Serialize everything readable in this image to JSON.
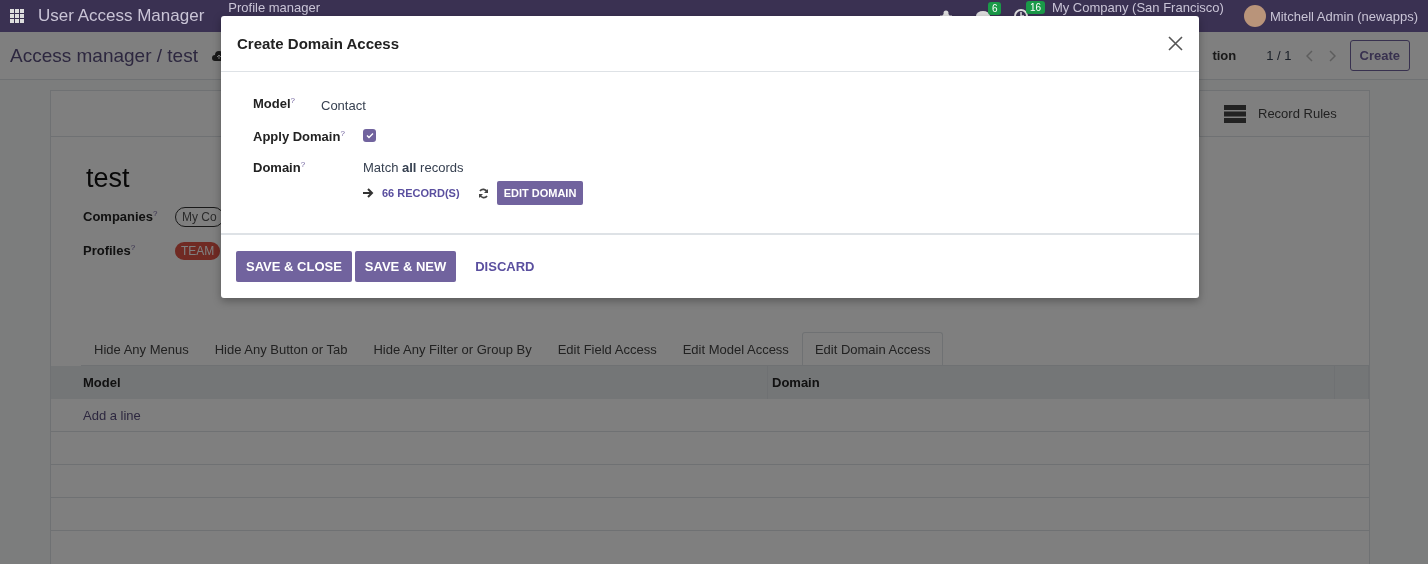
{
  "navbar": {
    "app_title": "User Access Manager",
    "menus": [
      "Profile manager"
    ],
    "messages_badge": "6",
    "activities_badge": "16",
    "company": "My Company (San Francisco)",
    "user": "Mitchell Admin (newapps)"
  },
  "control_panel": {
    "breadcrumb": "Access manager / test",
    "action_menu": "tion",
    "pager": "1 / 1",
    "create_button": "Create"
  },
  "form": {
    "stat_buttons": [
      "Record Rules"
    ],
    "title": "test",
    "fields": [
      {
        "label": "Companies$^{?}$",
        "tag": "My Co",
        "kind": "outline"
      },
      {
        "label": "Profiles$^{?}$",
        "tag": "TEAM",
        "kind": "filled"
      }
    ]
  },
  "notebook": {
    "tabs": [
      {
        "label": "Hide Any Menus",
        "selected": false
      },
      {
        "label": "Hide Any Button or Tab",
        "selected": false
      },
      {
        "label": "Hide Any Filter or Group By",
        "selected": false
      },
      {
        "label": "Edit Field Access",
        "selected": false
      },
      {
        "label": "Edit Model Access",
        "selected": false
      },
      {
        "label": "Edit Domain Access",
        "selected": true
      }
    ]
  },
  "table": {
    "columns": [
      "Model",
      "Domain"
    ],
    "add_line": "Add a line"
  },
  "dialog": {
    "title": "Create Domain Access",
    "fields": [
      {
        "kind": "text",
        "label": "Model$^{?}$",
        "value": "Contact"
      },
      {
        "kind": "checkbox",
        "label": "Apply Domain$^{?}$",
        "checked": true
      },
      {
        "kind": "domain",
        "label": "Domain$^{?}$",
        "summary": "Match **all** records",
        "records": "66 RECORD(S)",
        "button": "EDIT DOMAIN"
      }
    ],
    "buttons": [
      {
        "label": "SAVE & CLOSE",
        "kind": "primary"
      },
      {
        "label": "SAVE & NEW",
        "kind": "primary"
      },
      {
        "label": "DISCARD",
        "kind": "link"
      }
    ]
  }
}
